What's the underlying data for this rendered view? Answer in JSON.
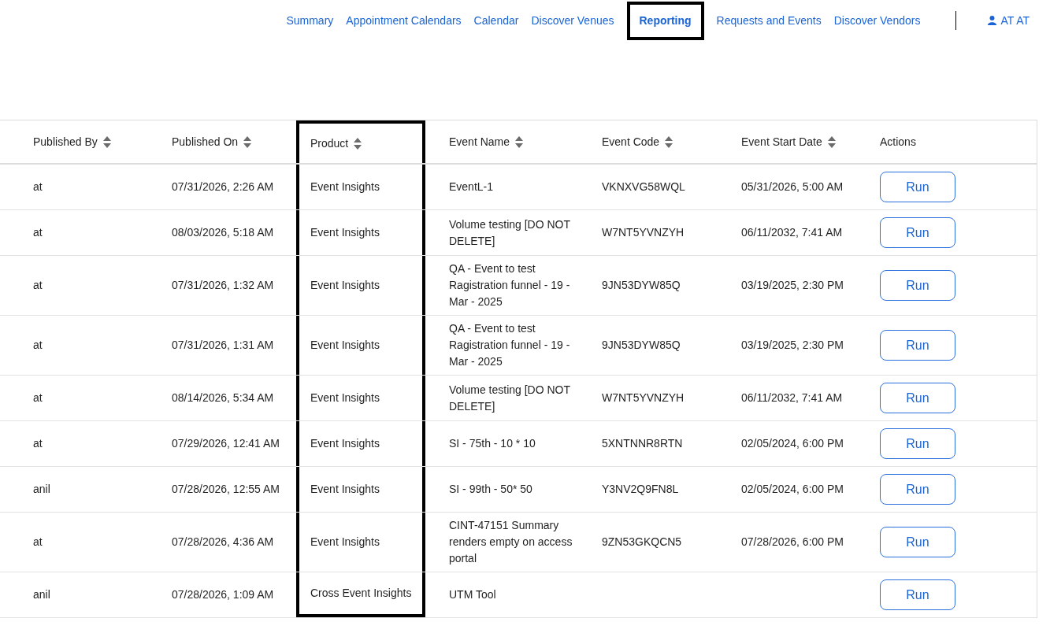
{
  "nav": {
    "items": [
      {
        "label": "Summary",
        "selected": false,
        "highlighted": false
      },
      {
        "label": "Appointment Calendars",
        "selected": false,
        "highlighted": false
      },
      {
        "label": "Calendar",
        "selected": false,
        "highlighted": false
      },
      {
        "label": "Discover Venues",
        "selected": false,
        "highlighted": false
      },
      {
        "label": "Reporting",
        "selected": true,
        "highlighted": true
      },
      {
        "label": "Requests and Events",
        "selected": false,
        "highlighted": false
      },
      {
        "label": "Discover Vendors",
        "selected": false,
        "highlighted": false
      }
    ],
    "user": {
      "label": "AT AT"
    }
  },
  "table": {
    "columns": [
      {
        "label": "Published By",
        "sortable": true,
        "highlighted": false
      },
      {
        "label": "Published On",
        "sortable": true,
        "highlighted": false
      },
      {
        "label": "Product",
        "sortable": true,
        "highlighted": true
      },
      {
        "label": "Event Name",
        "sortable": true,
        "highlighted": false
      },
      {
        "label": "Event Code",
        "sortable": true,
        "highlighted": false
      },
      {
        "label": "Event Start Date",
        "sortable": true,
        "highlighted": false
      },
      {
        "label": "Actions",
        "sortable": false,
        "highlighted": false
      }
    ],
    "rows": [
      {
        "cells": [
          "at",
          "07/31/2026, 2:26 AM",
          "Event Insights",
          "EventL-1",
          "VKNXVG58WQL",
          "05/31/2026, 5:00 AM"
        ],
        "action": "Run"
      },
      {
        "cells": [
          "at",
          "08/03/2026, 5:18 AM",
          "Event Insights",
          "Volume testing [DO NOT DELETE]",
          "W7NT5YVNZYH",
          "06/11/2032, 7:41 AM"
        ],
        "action": "Run"
      },
      {
        "cells": [
          "at",
          "07/31/2026, 1:32 AM",
          "Event Insights",
          "QA - Event to test Ragistration funnel - 19 - Mar - 2025",
          "9JN53DYW85Q",
          "03/19/2025, 2:30 PM"
        ],
        "action": "Run"
      },
      {
        "cells": [
          "at",
          "07/31/2026, 1:31 AM",
          "Event Insights",
          "QA - Event to test Ragistration funnel - 19 - Mar - 2025",
          "9JN53DYW85Q",
          "03/19/2025, 2:30 PM"
        ],
        "action": "Run"
      },
      {
        "cells": [
          "at",
          "08/14/2026, 5:34 AM",
          "Event Insights",
          "Volume testing [DO NOT DELETE]",
          "W7NT5YVNZYH",
          "06/11/2032, 7:41 AM"
        ],
        "action": "Run"
      },
      {
        "cells": [
          "at",
          "07/29/2026, 12:41 AM",
          "Event Insights",
          "SI - 75th - 10 * 10",
          "5XNTNNR8RTN",
          "02/05/2024, 6:00 PM"
        ],
        "action": "Run"
      },
      {
        "cells": [
          "anil",
          "07/28/2026, 12:55 AM",
          "Event Insights",
          "SI - 99th - 50* 50",
          "Y3NV2Q9FN8L",
          "02/05/2024, 6:00 PM"
        ],
        "action": "Run"
      },
      {
        "cells": [
          "at",
          "07/28/2026, 4:36 AM",
          "Event Insights",
          "CINT-47151 Summary renders empty on access portal",
          "9ZN53GKQCN5",
          "07/28/2026, 6:00 PM"
        ],
        "action": "Run"
      },
      {
        "cells": [
          "anil",
          "07/28/2026, 1:09 AM",
          "Cross Event Insights",
          "UTM Tool"
        ],
        "action": "Run"
      }
    ]
  }
}
